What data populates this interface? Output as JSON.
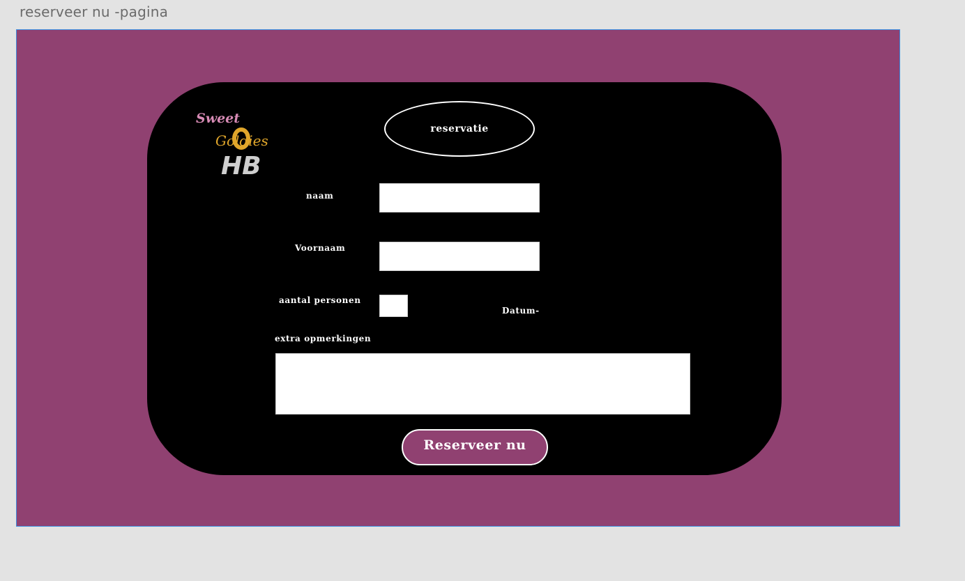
{
  "artboard": {
    "title": "reserveer nu -pagina"
  },
  "logo": {
    "line1": "Sweet",
    "line2": "Goldies",
    "monogram": "HB"
  },
  "header": {
    "title": "reservatie"
  },
  "form": {
    "naam_label": "naam",
    "naam_value": "",
    "voornaam_label": "Voornaam",
    "voornaam_value": "",
    "personen_label": "aantal personen",
    "personen_value": "",
    "datum_label": "Datum-",
    "opmerkingen_label": "extra opmerkingen",
    "opmerkingen_value": "",
    "submit_label": "Reserveer nu"
  },
  "colors": {
    "background": "#e3e3e3",
    "artboard": "#904171",
    "card": "#000000",
    "accent_pink": "#d78bb5",
    "accent_gold": "#e0a62b",
    "selection_border": "#3f8fe0"
  }
}
